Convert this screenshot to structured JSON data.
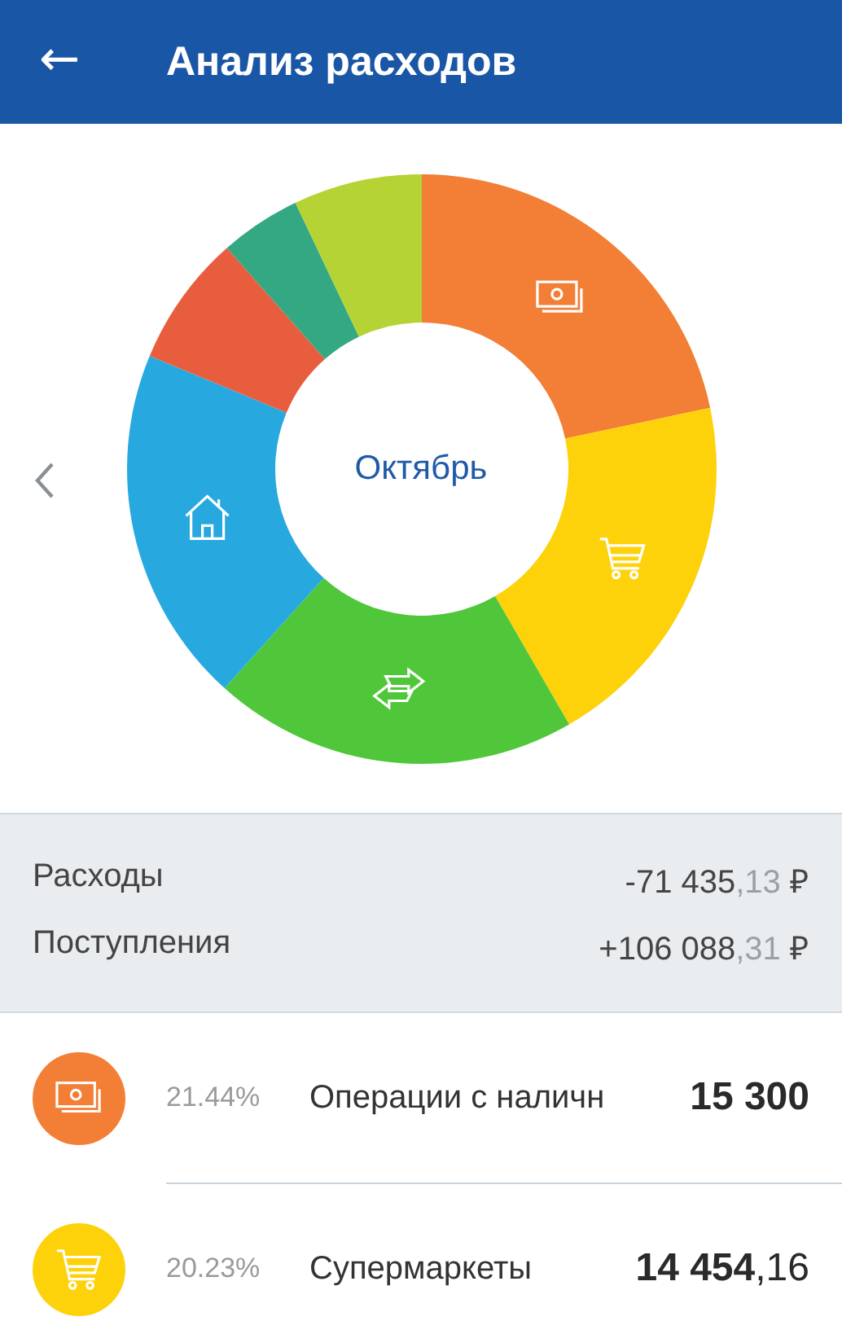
{
  "header": {
    "back_icon": "←",
    "title": "Анализ расходов"
  },
  "chart": {
    "center_label": "Октябрь",
    "segments": [
      {
        "color": "#f27f35",
        "kind": "cash"
      },
      {
        "color": "#fdd20b",
        "kind": "cart"
      },
      {
        "color": "#50c73a",
        "kind": "transfer"
      },
      {
        "color": "#27a9e0",
        "kind": "home"
      },
      {
        "color": "#e95d3f",
        "kind": "none"
      },
      {
        "color": "#34a882",
        "kind": "none"
      },
      {
        "color": "#b5d334",
        "kind": "none"
      }
    ]
  },
  "summary": [
    {
      "label": "Расходы",
      "whole": "-71 435",
      "fraction": ",13",
      "currency": "₽"
    },
    {
      "label": "Поступления",
      "whole": "+106 088",
      "fraction": ",31",
      "currency": "₽"
    }
  ],
  "categories": [
    {
      "color": "#f27f35",
      "kind": "cash",
      "percent": "21.44%",
      "name": "Операции с наличн",
      "whole": "15 300"
    },
    {
      "color": "#fdd20b",
      "kind": "cart",
      "percent": "20.23%",
      "name": "Супермаркеты",
      "whole": "14 454",
      "fraction": ",16"
    }
  ]
}
